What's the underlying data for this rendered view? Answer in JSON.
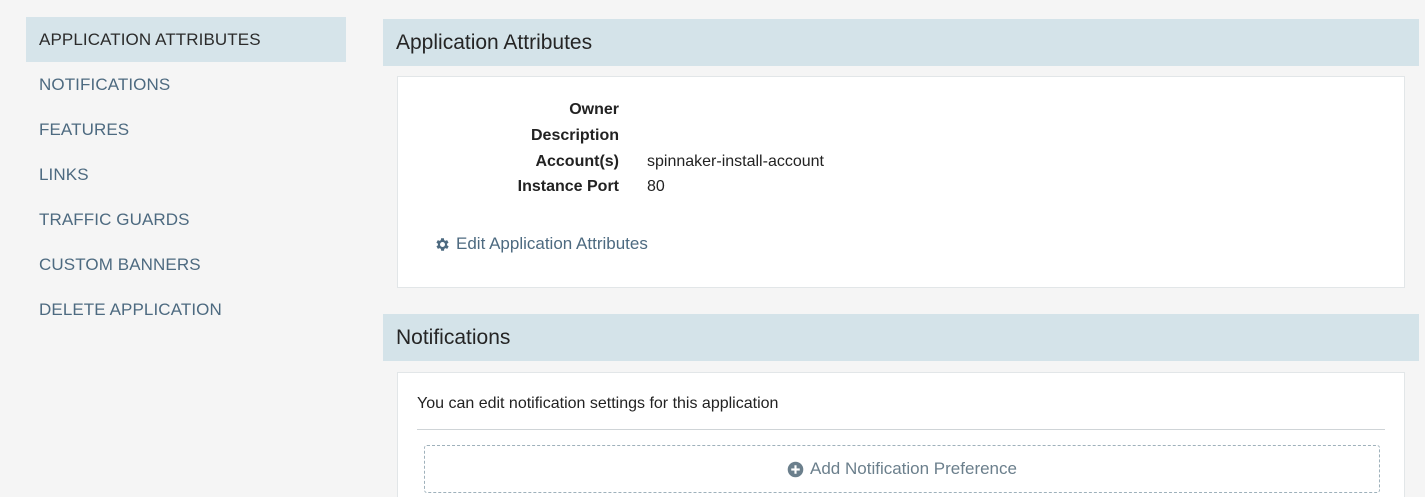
{
  "sidebar": {
    "items": [
      {
        "label": "APPLICATION ATTRIBUTES",
        "active": true
      },
      {
        "label": "NOTIFICATIONS"
      },
      {
        "label": "FEATURES"
      },
      {
        "label": "LINKS"
      },
      {
        "label": "TRAFFIC GUARDS"
      },
      {
        "label": "CUSTOM BANNERS"
      },
      {
        "label": "DELETE APPLICATION"
      }
    ]
  },
  "attributes": {
    "title": "Application Attributes",
    "rows": [
      {
        "label": "Owner",
        "value": ""
      },
      {
        "label": "Description",
        "value": ""
      },
      {
        "label": "Account(s)",
        "value": "spinnaker-install-account"
      },
      {
        "label": "Instance Port",
        "value": "80"
      }
    ],
    "edit_label": "Edit Application Attributes",
    "edit_icon": "gear-icon"
  },
  "notifications": {
    "title": "Notifications",
    "description": "You can edit notification settings for this application",
    "add_label": "Add Notification Preference",
    "add_icon": "plus-circle-icon"
  },
  "colors": {
    "accent_text": "#4d6a80",
    "header_bg": "#d4e3e9",
    "active_nav_bg": "#d6e4ea"
  }
}
